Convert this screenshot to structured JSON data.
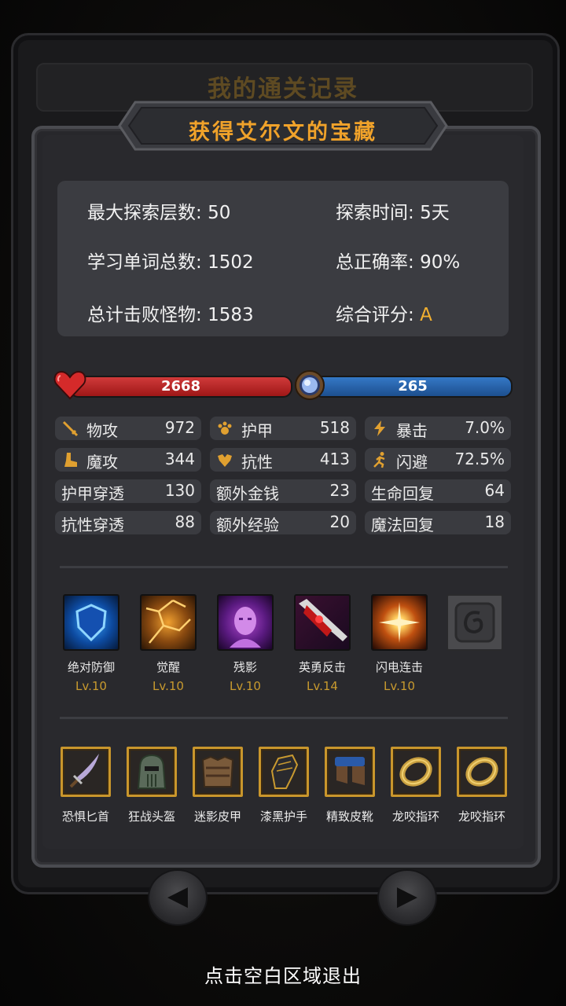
{
  "back_title": "我的通关记录",
  "title": "获得艾尔文的宝藏",
  "records": {
    "max_floor": {
      "label": "最大探索层数:",
      "value": "50"
    },
    "explore_time": {
      "label": "探索时间:",
      "value": "5天"
    },
    "total_words": {
      "label": "学习单词总数:",
      "value": "1502"
    },
    "accuracy": {
      "label": "总正确率:",
      "value": "90%"
    },
    "monsters": {
      "label": "总计击败怪物:",
      "value": "1583"
    },
    "rating": {
      "label": "综合评分:",
      "value": "A"
    }
  },
  "hp": "2668",
  "mp": "265",
  "stats": [
    {
      "label": "物攻",
      "value": "972",
      "icon": "sword-icon"
    },
    {
      "label": "护甲",
      "value": "518",
      "icon": "paw-armor-icon"
    },
    {
      "label": "暴击",
      "value": "7.0%",
      "icon": "lightning-icon"
    },
    {
      "label": "魔攻",
      "value": "344",
      "icon": "magic-boot-icon"
    },
    {
      "label": "抗性",
      "value": "413",
      "icon": "resistance-icon"
    },
    {
      "label": "闪避",
      "value": "72.5%",
      "icon": "running-man-icon"
    },
    {
      "label": "护甲穿透",
      "value": "130"
    },
    {
      "label": "额外金钱",
      "value": "23"
    },
    {
      "label": "生命回复",
      "value": "64"
    },
    {
      "label": "抗性穿透",
      "value": "88"
    },
    {
      "label": "额外经验",
      "value": "20"
    },
    {
      "label": "魔法回复",
      "value": "18"
    }
  ],
  "skills": [
    {
      "name": "绝对防御",
      "level": "Lv.10",
      "icon": "blue-shield-icon"
    },
    {
      "name": "觉醒",
      "level": "Lv.10",
      "icon": "awakening-cracks-icon"
    },
    {
      "name": "残影",
      "level": "Lv.10",
      "icon": "purple-face-icon"
    },
    {
      "name": "英勇反击",
      "level": "Lv.14",
      "icon": "bloody-blade-icon"
    },
    {
      "name": "闪电连击",
      "level": "Lv.10",
      "icon": "flash-burst-icon"
    },
    {
      "name": "",
      "level": "",
      "icon": "empty-skill-slot-icon"
    }
  ],
  "equipment": [
    {
      "name": "恐惧匕首",
      "icon": "dagger-icon"
    },
    {
      "name": "狂战头盔",
      "icon": "helmet-icon"
    },
    {
      "name": "迷影皮甲",
      "icon": "leather-armor-icon"
    },
    {
      "name": "漆黑护手",
      "icon": "gauntlet-icon"
    },
    {
      "name": "精致皮靴",
      "icon": "boots-icon"
    },
    {
      "name": "龙咬指环",
      "icon": "ring-icon"
    },
    {
      "name": "龙咬指环",
      "icon": "ring-icon"
    }
  ],
  "exit_hint": "点击空白区域退出",
  "colors": {
    "accent": "#f0a22a",
    "hp": "#c02a2a",
    "mp": "#2a66b0",
    "equip_frame": "#c9962c"
  }
}
